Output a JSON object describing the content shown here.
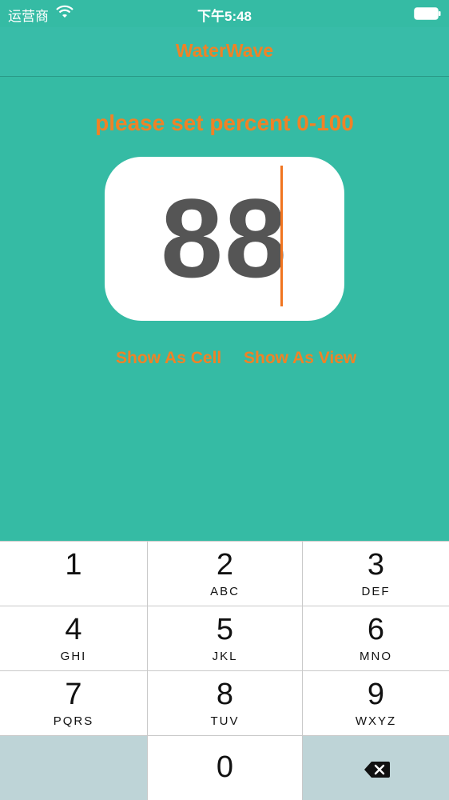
{
  "status": {
    "carrier": "运营商",
    "time": "下午5:48"
  },
  "nav": {
    "title": "WaterWave"
  },
  "main": {
    "prompt": "please set percent 0-100",
    "percent_value": "88",
    "show_as_cell": "Show As Cell",
    "show_as_view": "Show As View"
  },
  "keypad": {
    "keys": [
      {
        "digit": "1",
        "letters": ""
      },
      {
        "digit": "2",
        "letters": "ABC"
      },
      {
        "digit": "3",
        "letters": "DEF"
      },
      {
        "digit": "4",
        "letters": "GHI"
      },
      {
        "digit": "5",
        "letters": "JKL"
      },
      {
        "digit": "6",
        "letters": "MNO"
      },
      {
        "digit": "7",
        "letters": "PQRS"
      },
      {
        "digit": "8",
        "letters": "TUV"
      },
      {
        "digit": "9",
        "letters": "WXYZ"
      },
      {
        "digit": "0",
        "letters": ""
      }
    ]
  },
  "colors": {
    "background": "#35bba4",
    "accent": "#f08226",
    "key_dark": "#bed4d7"
  },
  "icons": {
    "wifi": "wifi-icon",
    "battery": "battery-icon",
    "backspace": "backspace-icon"
  }
}
